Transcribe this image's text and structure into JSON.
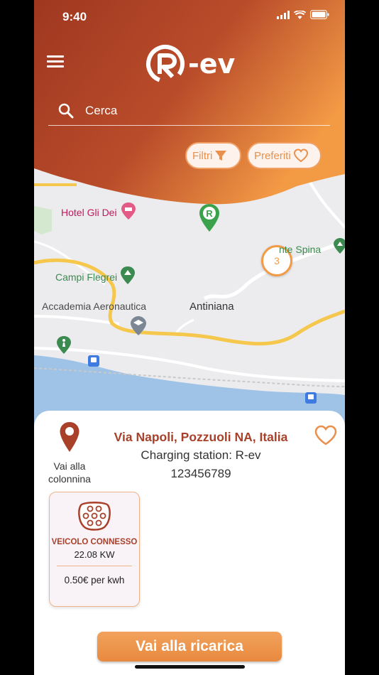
{
  "status": {
    "time": "9:40"
  },
  "brand": {
    "logo_text": "-ev"
  },
  "search": {
    "placeholder": "Cerca"
  },
  "chips": {
    "filter_label": "Filtri",
    "favorites_label": "Preferiti"
  },
  "map": {
    "labels": {
      "hotel": "Hotel Gli Dei",
      "monte_spina": "nte Spina",
      "campi_flegrei": "Campi Flegrei",
      "accademia": "Accademia Aeronautica",
      "antiniana": "Antiniana"
    },
    "cluster_count": "3"
  },
  "station": {
    "navigate_label": "Vai alla colonnina",
    "address": "Via Napoli, Pozzuoli NA, Italia",
    "name": "Charging station: R-ev",
    "code": "123456789"
  },
  "connector": {
    "status": "VEICOLO CONNESSO",
    "power": "22.08 KW",
    "price": "0.50€ per kwh"
  },
  "cta": {
    "label": "Vai alla ricarica"
  },
  "colors": {
    "brand_dark": "#a3391f",
    "brand_light": "#f39a45",
    "accent_text": "#a8402a"
  }
}
